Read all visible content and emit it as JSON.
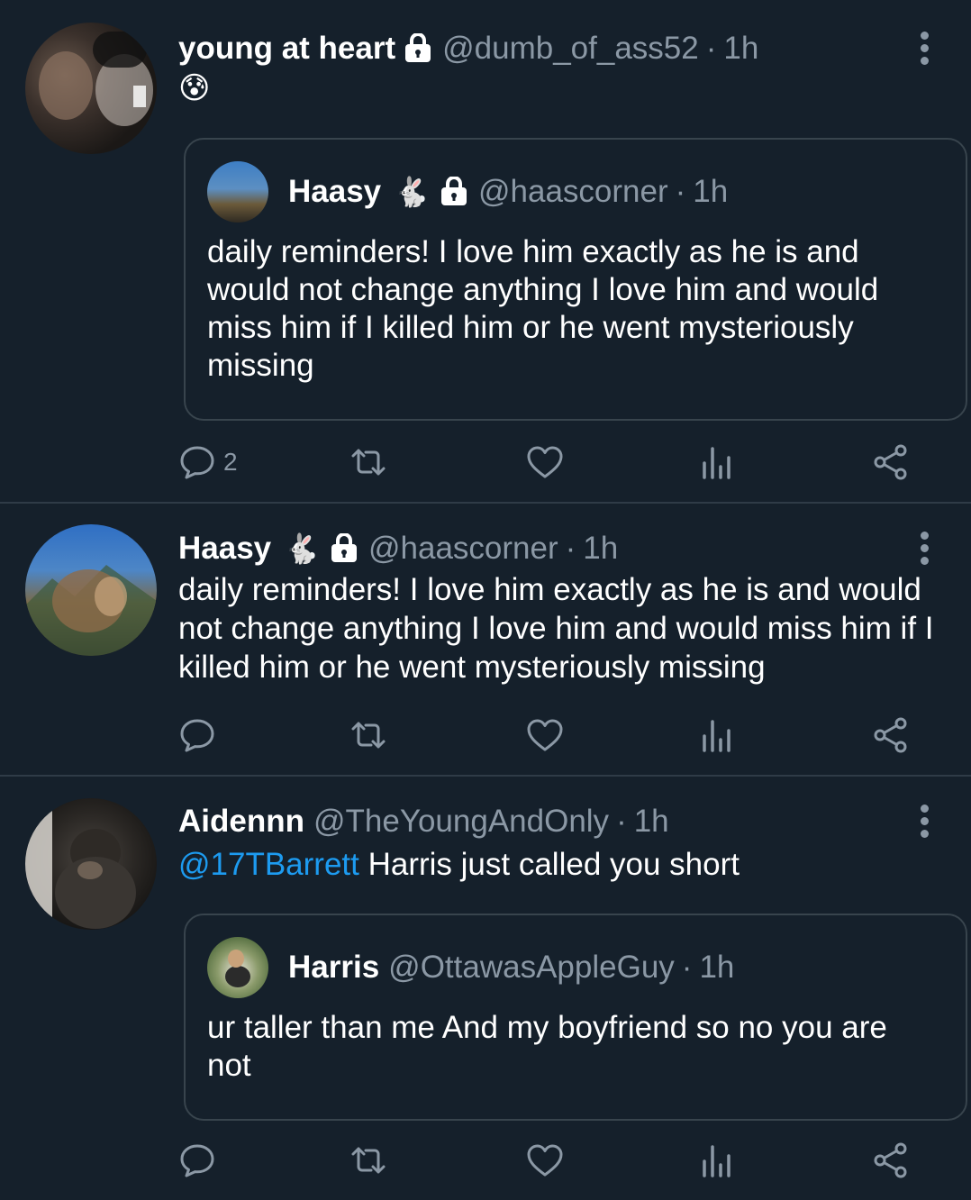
{
  "tweets": [
    {
      "name": "young at heart",
      "handle": "@dumb_of_ass52",
      "time": "1h",
      "emoji": "😰",
      "quote": {
        "name": "Haasy",
        "emoji": "🐇",
        "handle": "@haascorner",
        "time": "1h",
        "text": "daily reminders! I love him exactly as he is and would not change anything I love him and would miss him if I killed him or he went mysteriously missing"
      },
      "reply_count": "2"
    },
    {
      "name": "Haasy",
      "emoji": "🐇",
      "handle": "@haascorner",
      "time": "1h",
      "text": "daily reminders! I love him exactly as he is and would not change anything I love him and would miss him if I killed him or he went mysteriously missing"
    },
    {
      "name": "Aidennn",
      "handle": "@TheYoungAndOnly",
      "time": "1h",
      "mention": "@17TBarrett",
      "text": " Harris just called you short",
      "quote": {
        "name": "Harris",
        "handle": "@OttawasAppleGuy",
        "time": "1h",
        "text": "ur taller than me And my boyfriend so no you are not"
      }
    }
  ],
  "separator": "·",
  "icons": [
    "lock-icon",
    "more-icon",
    "reply-icon",
    "retweet-icon",
    "like-icon",
    "views-icon",
    "share-icon"
  ],
  "colors": {
    "background": "#15202b",
    "secondary_text": "#8b98a5",
    "link": "#1d9bf0",
    "border": "#38444d"
  }
}
